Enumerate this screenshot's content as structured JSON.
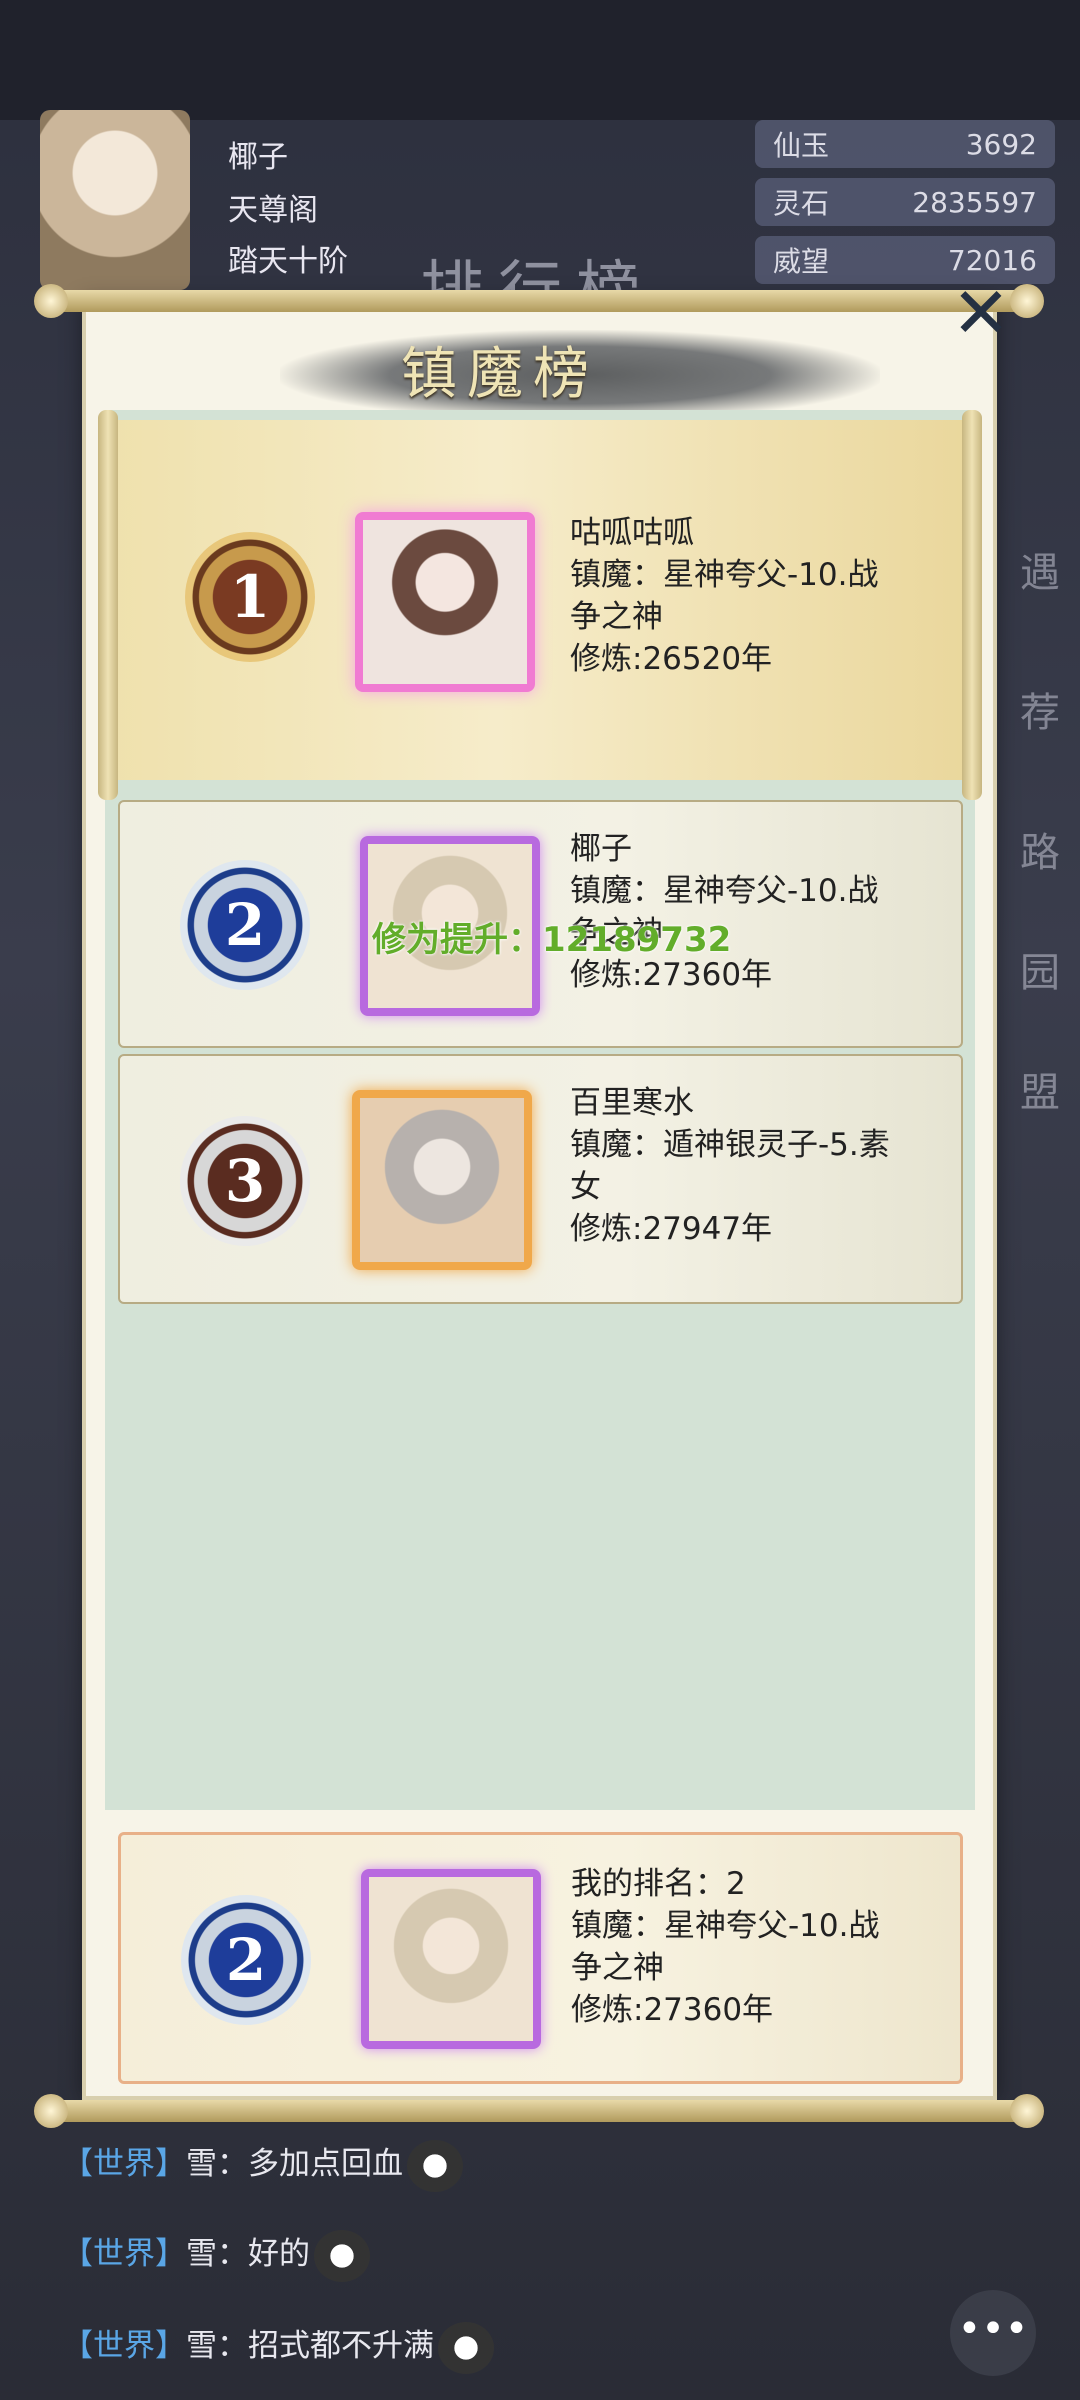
{
  "player": {
    "name": "椰子",
    "sect": "天尊阁",
    "realm": "踏天十阶"
  },
  "resources": [
    {
      "label": "仙玉",
      "value": "3692"
    },
    {
      "label": "灵石",
      "value": "2835597"
    },
    {
      "label": "威望",
      "value": "72016"
    }
  ],
  "background": {
    "title": "排行榜",
    "side_labels": [
      "遇",
      "荐",
      "路",
      "园",
      "盟"
    ]
  },
  "panel": {
    "title": "镇魔榜",
    "close_icon": "close-icon"
  },
  "rankings": [
    {
      "rank": "1",
      "name": "咕呱咕呱",
      "zhenmo_line1": "镇魔：星神夸父-10.战",
      "zhenmo_line2": "争之神",
      "cultivation": "修炼:26520年"
    },
    {
      "rank": "2",
      "name": "椰子",
      "zhenmo_line1": "镇魔：星神夸父-10.战",
      "zhenmo_line2": "争之神",
      "cultivation": "修炼:27360年"
    },
    {
      "rank": "3",
      "name": "百里寒水",
      "zhenmo_line1": "镇魔：遁神银灵子-5.素",
      "zhenmo_line2": "女",
      "cultivation": "修炼:27947年"
    }
  ],
  "my_rank": {
    "rank": "2",
    "label": "我的排名：2",
    "zhenmo_line1": "镇魔：星神夸父-10.战",
    "zhenmo_line2": "争之神",
    "cultivation": "修炼:27360年"
  },
  "floating_text": "修为提升：12189732",
  "chat": [
    {
      "channel": "【世界】",
      "message": "雪：多加点回血"
    },
    {
      "channel": "【世界】",
      "message": "雪：好的"
    },
    {
      "channel": "【世界】",
      "message": "雪：招式都不升满"
    }
  ],
  "chat_button_icon": "chat-bubble-icon",
  "colors": {
    "panel_bg": "#f7f4e8",
    "list_bg": "#d3e2d5",
    "chat_channel": "#5aa6e6",
    "floating_text": "#62ad2a"
  }
}
